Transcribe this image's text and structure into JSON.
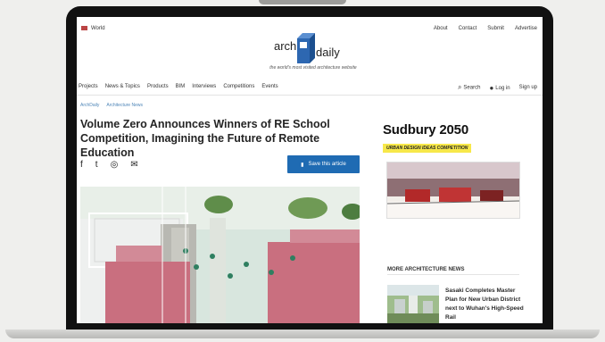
{
  "site": {
    "region": "World",
    "top_links": [
      "About",
      "Contact",
      "Submit",
      "Advertise"
    ],
    "logo_left": "arch",
    "logo_right": "daily",
    "tagline": "the world's most visited architecture website"
  },
  "nav": {
    "items": [
      "Projects",
      "News & Topics",
      "Products",
      "BIM",
      "Interviews",
      "Competitions",
      "Events"
    ],
    "search": "Search",
    "login": "Log in",
    "signup": "Sign up"
  },
  "article": {
    "breadcrumb": [
      "ArchDaily",
      "Architecture News"
    ],
    "title": "Volume Zero Announces Winners of RE School Competition, Imagining the Future of Remote Education",
    "save_label": "Save this article"
  },
  "sidebar": {
    "ad_title": "Sudbury 2050",
    "ad_subtitle": "URBAN DESIGN IDEAS COMPETITION",
    "more_heading": "MORE ARCHITECTURE NEWS",
    "more_item": "Sasaki Completes Master Plan for New Urban District next to Wuhan's High-Speed Rail"
  },
  "colors": {
    "accent_blue": "#1f6bb3",
    "ad_yellow": "#f7e84a",
    "hero_pink": "#c96f7f"
  }
}
